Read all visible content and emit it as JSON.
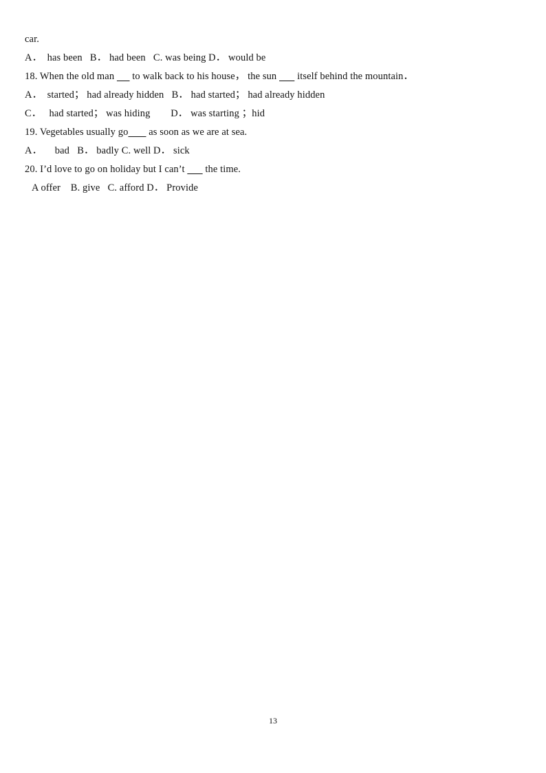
{
  "document": {
    "page_number": "13",
    "lines": [
      {
        "id": "line-car",
        "segments": [
          {
            "type": "text",
            "value": "car."
          }
        ]
      },
      {
        "id": "line-q17-options",
        "segments": [
          {
            "type": "text",
            "value": "A．  has been   B． had been   C. was being D． would be"
          }
        ]
      },
      {
        "id": "line-q18-stem",
        "segments": [
          {
            "type": "text",
            "value": "18. When the old man "
          },
          {
            "type": "blank",
            "value": "     "
          },
          {
            "type": "text",
            "value": " to walk back to his house， the sun "
          },
          {
            "type": "blank",
            "value": "      "
          },
          {
            "type": "text",
            "value": " itself behind the mountain．"
          }
        ]
      },
      {
        "id": "line-q18-options-ab",
        "segments": [
          {
            "type": "text",
            "value": "A．  started； had already hidden   B． had started； had already hidden"
          }
        ]
      },
      {
        "id": "line-q18-options-cd",
        "segments": [
          {
            "type": "text",
            "value": "C．   had started； was hiding        D． was starting ；hid"
          }
        ]
      },
      {
        "id": "line-q19-stem",
        "segments": [
          {
            "type": "text",
            "value": "19. Vegetables usually go"
          },
          {
            "type": "blank",
            "value": "       "
          },
          {
            "type": "text",
            "value": " as soon as we are at sea."
          }
        ]
      },
      {
        "id": "line-q19-options",
        "segments": [
          {
            "type": "text",
            "value": "A．     bad   B． badly C. well D． sick"
          }
        ]
      },
      {
        "id": "line-q20-stem",
        "segments": [
          {
            "type": "text",
            "value": "20. I’d love to go on holiday but I can’t "
          },
          {
            "type": "blank",
            "value": "      "
          },
          {
            "type": "text",
            "value": " the time."
          }
        ]
      },
      {
        "id": "line-q20-options",
        "indent": true,
        "segments": [
          {
            "type": "text",
            "value": "A offer    B. give   C. afford D． Provide"
          }
        ]
      }
    ]
  }
}
